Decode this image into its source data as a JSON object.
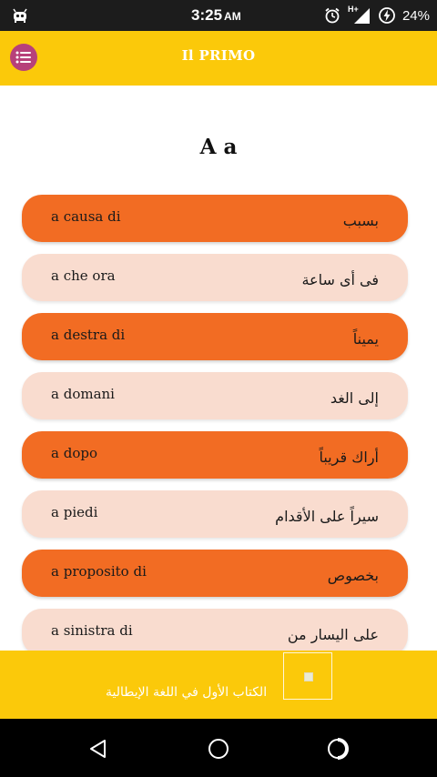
{
  "status_bar": {
    "time": "3:25",
    "ampm": "AM",
    "network_label": "H+",
    "battery": "24%"
  },
  "app_bar": {
    "title": "Il PRIMO"
  },
  "section": {
    "heading": "A a"
  },
  "words": [
    {
      "italian": "a causa di",
      "arabic": "بسبب",
      "style": "dark"
    },
    {
      "italian": "a che ora",
      "arabic": "فى أى ساعة",
      "style": "light"
    },
    {
      "italian": "a destra di",
      "arabic": "يميناً",
      "style": "dark"
    },
    {
      "italian": "a domani",
      "arabic": "إلى الغد",
      "style": "light"
    },
    {
      "italian": "a dopo",
      "arabic": "أراك قريباً",
      "style": "dark"
    },
    {
      "italian": "a piedi",
      "arabic": "سيراً على الأقدام",
      "style": "light"
    },
    {
      "italian": "a proposito di",
      "arabic": "بخصوص",
      "style": "dark"
    },
    {
      "italian": "a sinistra di",
      "arabic": "على اليسار من",
      "style": "light"
    }
  ],
  "banner": {
    "text": "الكتاب الأول في اللغة الإيطالية"
  },
  "colors": {
    "accent_yellow": "#fbc90a",
    "row_dark": "#f26c23",
    "row_light": "#f9dccf",
    "menu_button": "#b7407a"
  }
}
